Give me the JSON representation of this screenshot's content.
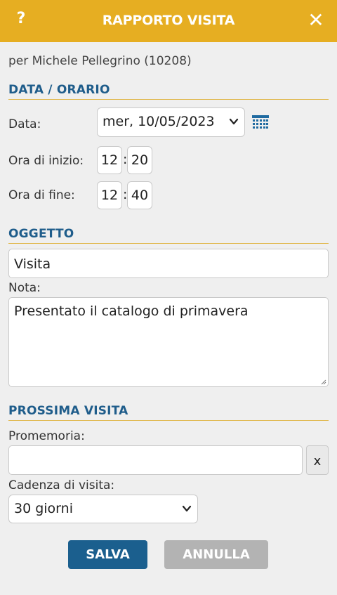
{
  "header": {
    "help_label": "?",
    "title": "RAPPORTO VISITA",
    "close_label": "✕"
  },
  "subject": "per Michele Pellegrino (10208)",
  "sections": {
    "date_time": "DATA / ORARIO",
    "object": "OGGETTO",
    "next_visit": "PROSSIMA VISITA"
  },
  "date_time": {
    "date_label": "Data:",
    "date_value": "mer, 10/05/2023",
    "start_label": "Ora di inizio:",
    "start_hour": "12",
    "start_minute": "20",
    "end_label": "Ora di fine:",
    "end_hour": "12",
    "end_minute": "40",
    "separator": ":"
  },
  "object": {
    "subject_value": "Visita",
    "note_label": "Nota:",
    "note_value": "Presentato il catalogo di primavera"
  },
  "next_visit": {
    "reminder_label": "Promemoria:",
    "reminder_value": "",
    "clear_label": "x",
    "cadence_label": "Cadenza di visita:",
    "cadence_value": "30 giorni"
  },
  "buttons": {
    "save": "SALVA",
    "cancel": "ANNULLA"
  },
  "colors": {
    "header": "#e6ae22",
    "section_title": "#1f5d8b",
    "save": "#1b5f8e",
    "cancel": "#b3b3b3"
  },
  "icons": {
    "help": "help-icon",
    "close": "close-icon",
    "calendar": "calendar-icon",
    "chevron": "chevron-down-icon"
  }
}
